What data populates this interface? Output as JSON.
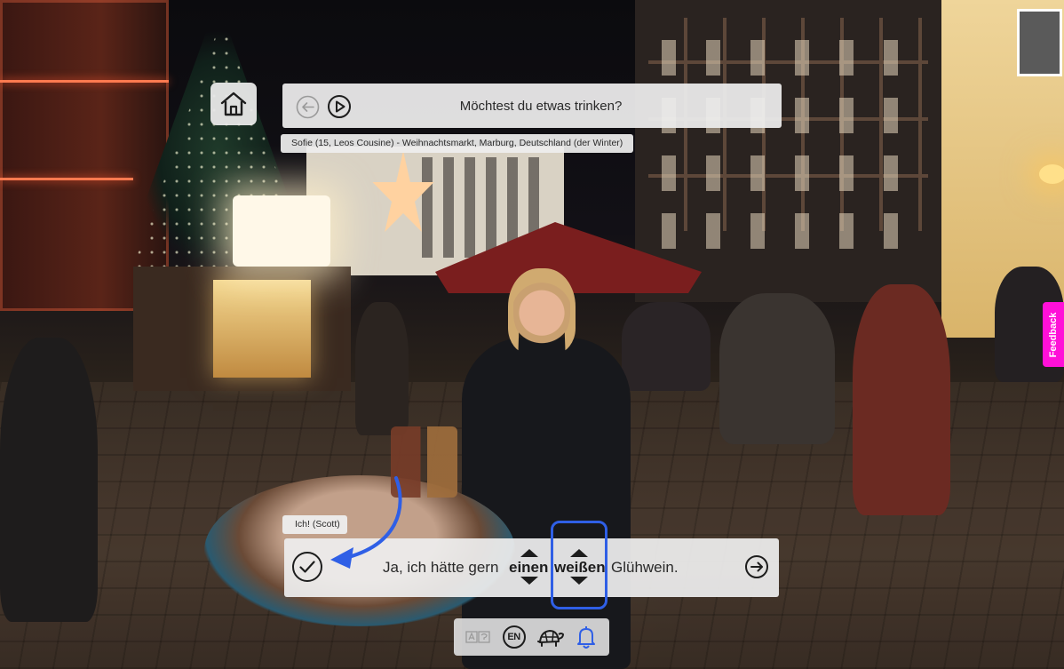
{
  "prompt": {
    "text": "Möchtest du etwas trinken?",
    "speaker": "Sofie (15, Leos Cousine) - Weihnachtsmarkt, Marburg, Deutschland (der Winter)"
  },
  "reply": {
    "speaker": "Ich! (Scott)",
    "prefix": "Ja, ich hätte gern",
    "word1": "einen",
    "word2": "weißen",
    "suffix": "Glühwein."
  },
  "toolbar": {
    "language": "EN"
  },
  "feedback": {
    "label": "Feedback"
  },
  "colors": {
    "hint": "#2f5fe6",
    "feedback": "#ff10d8",
    "panel": "#eeeeee"
  },
  "icons": {
    "home": "home-icon",
    "back": "arrow-left-circle-icon",
    "play": "play-circle-icon",
    "check": "check-circle-icon",
    "next": "arrow-right-circle-icon",
    "font": "font-size-icon",
    "slow": "turtle-icon",
    "bell": "bell-icon"
  }
}
